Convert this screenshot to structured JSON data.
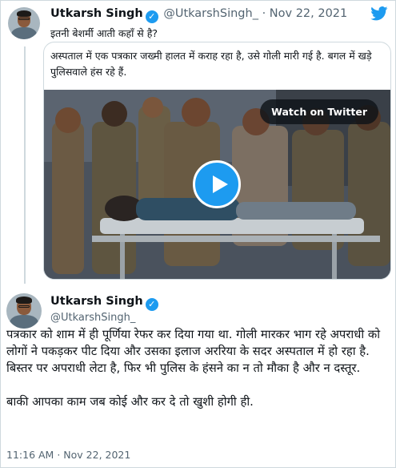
{
  "parent_tweet": {
    "author_name": "Utkarsh Singh",
    "handle": "@UtkarshSingh_",
    "separator": "·",
    "date": "Nov 22, 2021",
    "text": "इतनी बेशर्मी आती कहाँ से है?",
    "quoted_text": "अस्पताल में एक पत्रकार जख्मी हालत में कराह रहा है, उसे गोली मारी गई है. बगल में खड़े पुलिसवाले हंस रहे हैं.",
    "video": {
      "watch_label": "Watch on Twitter"
    }
  },
  "main_tweet": {
    "author_name": "Utkarsh Singh",
    "handle": "@UtkarshSingh_",
    "body": "पत्रकार को शाम में ही पूर्णिया रेफर कर दिया गया था. गोली मारकर भाग रहे अपराधी को लोगों ने पकड़कर पीट दिया और उसका इलाज अररिया के सदर अस्पताल में हो रहा है. बिस्तर पर अपराधी लेटा है, फिर भी पुलिस के हंसने का न तो मौका है और न दस्तूर.\n\nबाकी आपका काम जब कोई और कर दे तो खुशी होगी ही.",
    "time": "11:16 AM",
    "separator": "·",
    "date": "Nov 22, 2021"
  },
  "colors": {
    "accent": "#1d9bf0",
    "muted": "#536471",
    "border": "#cfd9de"
  },
  "icons": [
    "verified-badge-icon",
    "twitter-bird-icon",
    "play-icon"
  ]
}
